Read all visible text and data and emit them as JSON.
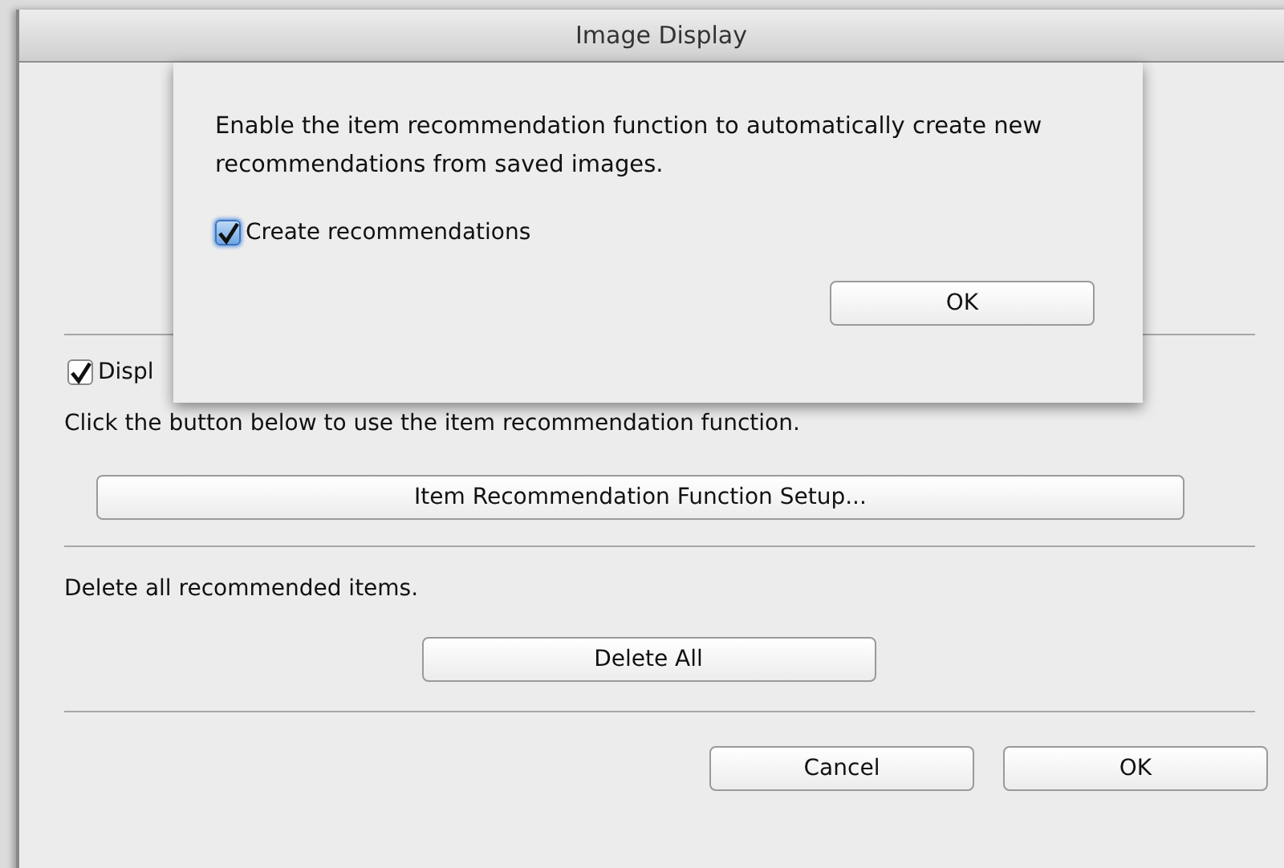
{
  "window": {
    "title": "Image Display"
  },
  "sheet": {
    "message": "Enable the item recommendation function to automatically create new recommendations from saved images.",
    "checkbox": {
      "label": "Create recommendations",
      "checked": true
    },
    "ok_button": "OK"
  },
  "startup_checkbox": {
    "label": "Displ",
    "checked": true
  },
  "setup_text": "Click the button below to use the item recommendation function.",
  "setup_button": "Item Recommendation Function Setup...",
  "delete_text": "Delete all recommended items.",
  "delete_button": "Delete All",
  "buttons": [
    {
      "label": "Cancel"
    },
    {
      "label": "OK"
    }
  ]
}
